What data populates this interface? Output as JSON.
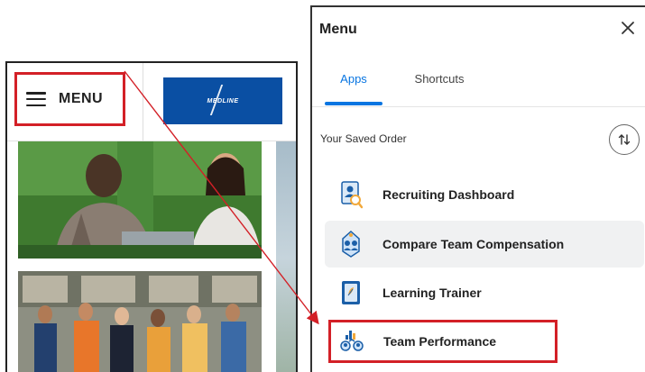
{
  "left_screen": {
    "menu_button": {
      "label": "MENU",
      "icon": "hamburger-icon"
    },
    "brand": {
      "logo_text": "MEDLINE"
    },
    "photos": [
      "team-meeting-photo",
      "warehouse-team-photo"
    ]
  },
  "menu_panel": {
    "title": "Menu",
    "close_icon": "close-icon",
    "tabs": [
      {
        "label": "Apps",
        "active": true
      },
      {
        "label": "Shortcuts",
        "active": false
      }
    ],
    "section_label": "Your Saved Order",
    "reorder_icon": "reorder-arrows-icon",
    "apps": [
      {
        "label": "Recruiting Dashboard",
        "icon": "recruiting-dashboard-icon"
      },
      {
        "label": "Compare Team Compensation",
        "icon": "compensation-icon"
      },
      {
        "label": "Learning Trainer",
        "icon": "learning-icon"
      },
      {
        "label": "Team Performance",
        "icon": "team-performance-icon"
      }
    ]
  },
  "colors": {
    "highlight_red": "#d32027",
    "accent_blue": "#0875e1",
    "brand_blue": "#0a4fa3"
  }
}
